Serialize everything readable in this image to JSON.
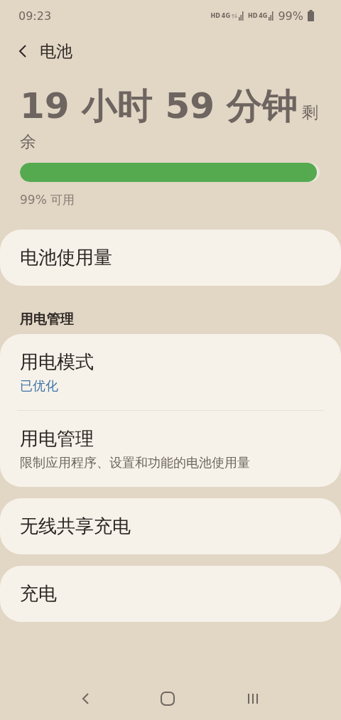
{
  "status_bar": {
    "time": "09:23",
    "networks": [
      {
        "kind": "data",
        "hd": "HD",
        "type": "4G"
      },
      {
        "kind": "idle",
        "hd": "HD",
        "type": "4G"
      }
    ],
    "battery": "99%"
  },
  "header": {
    "title": "电池"
  },
  "summary": {
    "time_left": "19 小时 59 分钟",
    "suffix": "剩余",
    "level": 0.99,
    "reading": "99% 可用"
  },
  "groups": [
    {
      "items": [
        {
          "title": "电池使用量"
        }
      ]
    },
    {
      "heading": "用电管理",
      "items": [
        {
          "title": "用电模式",
          "value": "已优化"
        },
        {
          "title": "用电管理",
          "subtitle": "限制应用程序、设置和功能的电池使用量"
        }
      ]
    },
    {
      "items": [
        {
          "title": "无线共享充电"
        }
      ]
    },
    {
      "items": [
        {
          "title": "充电"
        }
      ]
    }
  ]
}
